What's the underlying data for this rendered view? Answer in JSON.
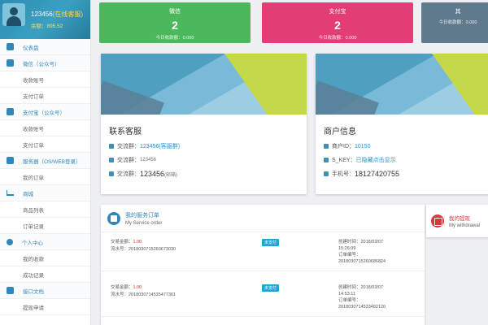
{
  "sidebar": {
    "username": "123456",
    "user_tag": "(在线客服)",
    "balance": "余额：895.52",
    "items": [
      {
        "type": "group",
        "label": "仪表盘",
        "icon": "grid-icon"
      },
      {
        "type": "group",
        "label": "微信（公众号）",
        "icon": "wechat-icon"
      },
      {
        "type": "sub",
        "label": "收款账号"
      },
      {
        "type": "sub",
        "label": "支付订单"
      },
      {
        "type": "group",
        "label": "支付宝（公众号）",
        "icon": "alipay-icon"
      },
      {
        "type": "sub",
        "label": "收款账号"
      },
      {
        "type": "sub",
        "label": "支付订单"
      },
      {
        "type": "group",
        "label": "服务器（OS/WEB登录）",
        "icon": "server-icon"
      },
      {
        "type": "sub",
        "label": "我的订单"
      },
      {
        "type": "group",
        "label": "商城",
        "icon": "cart-icon"
      },
      {
        "type": "sub",
        "label": "商品列表"
      },
      {
        "type": "sub",
        "label": "订单记录"
      },
      {
        "type": "group",
        "label": "个人中心",
        "icon": "person-icon"
      },
      {
        "type": "sub",
        "label": "我的收款"
      },
      {
        "type": "sub",
        "label": "成功记录"
      },
      {
        "type": "group",
        "label": "接口文档",
        "icon": "doc-icon"
      },
      {
        "type": "sub",
        "label": "提现申请"
      }
    ]
  },
  "stats": [
    {
      "title": "微信",
      "value": "2",
      "sub": "今日收款额：0.000",
      "color": "#4cb85c"
    },
    {
      "title": "支付宝",
      "value": "2",
      "sub": "今日收款额：0.000",
      "color": "#e43d75"
    },
    {
      "title": "其",
      "value": "",
      "sub": "今日收款额：0.000",
      "color": "#5e7a8c"
    }
  ],
  "contact_card": {
    "title": "联系客服",
    "qq_label": "交流群：",
    "qq_value": "123456",
    "qq_note": "(客服群)",
    "wechat_label": "交流群：",
    "wechat_value": "123456",
    "mail_label": "交流群：",
    "mail_value": "123456",
    "mail_note": "(邮箱)"
  },
  "merchant_card": {
    "title": "商户信息",
    "id_label": "商户ID：",
    "id_value": "10150",
    "key_label": "S_KEY：",
    "key_value": "已隐藏点击显示",
    "phone_label": "手机号：",
    "phone_value": "18127420755"
  },
  "orders": {
    "title": "我的服务订单",
    "subtitle": "My Service order",
    "rows": [
      {
        "amount_label": "交易金额：",
        "amount": "1.00",
        "order_no": "流水号：2018030715260673030",
        "badge": "未支付",
        "time_label": "创建时间：2018/03/07",
        "time": "15:26:09",
        "order_label": "订单编号：",
        "order_id": "2018030715260686824"
      },
      {
        "amount_label": "交易金额：",
        "amount": "1.00",
        "order_no": "流水号：2018030714535477361",
        "badge": "未支付",
        "time_label": "创建时间：2018/03/07",
        "time": "14:53:11",
        "order_label": "订单编号：",
        "order_id": "2018030714533482120"
      }
    ]
  },
  "withdraw": {
    "title": "我的提现",
    "subtitle": "My withdrawal"
  }
}
